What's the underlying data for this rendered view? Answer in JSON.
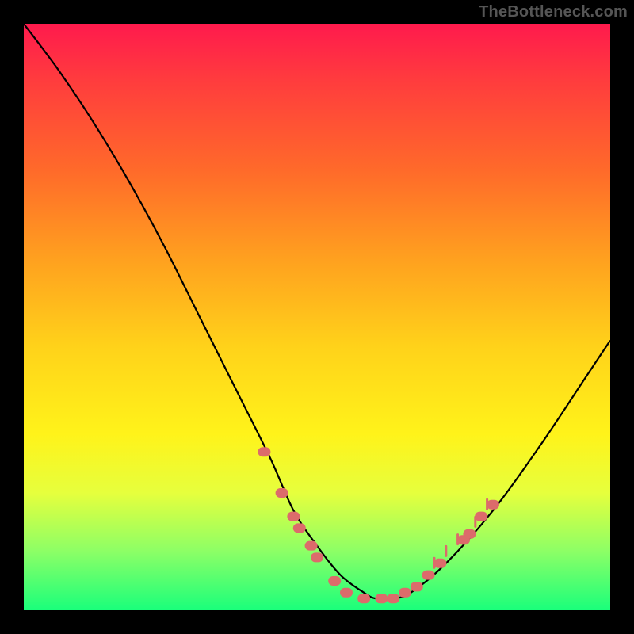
{
  "watermark": "TheBottleneck.com",
  "chart_data": {
    "type": "line",
    "title": "",
    "xlabel": "",
    "ylabel": "",
    "xlim": [
      0,
      100
    ],
    "ylim": [
      0,
      100
    ],
    "series": [
      {
        "name": "bottleneck-curve",
        "x": [
          0,
          6,
          12,
          18,
          24,
          30,
          36,
          42,
          46,
          50,
          54,
          58,
          60,
          63,
          66,
          72,
          80,
          88,
          96,
          100
        ],
        "values": [
          100,
          92,
          83,
          73,
          62,
          50,
          38,
          26,
          17,
          11,
          6,
          3,
          2,
          2,
          3,
          8,
          17,
          28,
          40,
          46
        ]
      }
    ],
    "markers": {
      "name": "highlighted-points",
      "color": "#dc6b6b",
      "points": [
        {
          "x": 41,
          "y": 27
        },
        {
          "x": 44,
          "y": 20
        },
        {
          "x": 46,
          "y": 16
        },
        {
          "x": 47,
          "y": 14
        },
        {
          "x": 49,
          "y": 11
        },
        {
          "x": 50,
          "y": 9
        },
        {
          "x": 53,
          "y": 5
        },
        {
          "x": 55,
          "y": 3
        },
        {
          "x": 58,
          "y": 2
        },
        {
          "x": 61,
          "y": 2
        },
        {
          "x": 63,
          "y": 2
        },
        {
          "x": 65,
          "y": 3
        },
        {
          "x": 67,
          "y": 4
        },
        {
          "x": 69,
          "y": 6
        },
        {
          "x": 71,
          "y": 8
        },
        {
          "x": 75,
          "y": 12
        },
        {
          "x": 76,
          "y": 13
        },
        {
          "x": 78,
          "y": 16
        },
        {
          "x": 80,
          "y": 18
        }
      ]
    },
    "ticks": {
      "name": "right-branch-ticks",
      "color": "#dc6b6b",
      "points": [
        {
          "x": 70,
          "y": 7
        },
        {
          "x": 72,
          "y": 9
        },
        {
          "x": 74,
          "y": 11
        },
        {
          "x": 77,
          "y": 14
        },
        {
          "x": 79,
          "y": 17
        }
      ]
    },
    "gradient_stops": [
      {
        "pos": 0,
        "color": "#ff1a4d"
      },
      {
        "pos": 10,
        "color": "#ff3d3d"
      },
      {
        "pos": 25,
        "color": "#ff6a2a"
      },
      {
        "pos": 40,
        "color": "#ffa01f"
      },
      {
        "pos": 55,
        "color": "#ffd21a"
      },
      {
        "pos": 70,
        "color": "#fff31a"
      },
      {
        "pos": 80,
        "color": "#e6ff3d"
      },
      {
        "pos": 90,
        "color": "#8cff66"
      },
      {
        "pos": 100,
        "color": "#1aff7b"
      }
    ]
  }
}
